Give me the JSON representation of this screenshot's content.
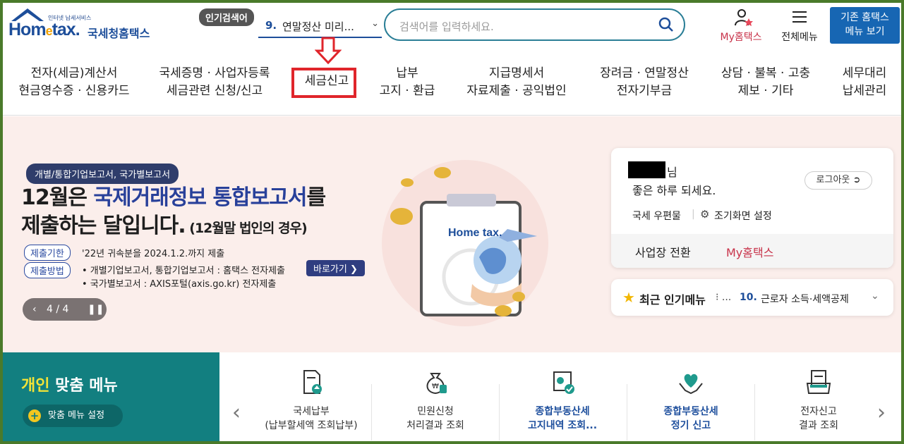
{
  "header": {
    "logo_tagline": "인터넷 납세서비스",
    "logo_word_a": "Hom",
    "logo_word_e": "e",
    "logo_word_b": "tax.",
    "logo_korean": "국세청홈택스",
    "popular_badge": "인기검색어",
    "popular_rank": "9.",
    "popular_term": "연말정산 미리...",
    "search_placeholder": "검색어를 입력하세요.",
    "my_hometax": "My홈택스",
    "all_menu": "전체메뉴",
    "old_menu_line1": "기존 홈택스",
    "old_menu_line2": "메뉴 보기"
  },
  "nav": [
    {
      "line1": "전자(세금)계산서",
      "line2": "현금영수증 · 신용카드"
    },
    {
      "line1": "국세증명 · 사업자등록",
      "line2": "세금관련 신청/신고"
    },
    {
      "line1": "세금신고",
      "line2": ""
    },
    {
      "line1": "납부",
      "line2": "고지 · 환급"
    },
    {
      "line1": "지급명세서",
      "line2": "자료제출 · 공익법인"
    },
    {
      "line1": "장려금 · 연말정산",
      "line2": "전자기부금"
    },
    {
      "line1": "상담 · 불복 · 고충",
      "line2": "제보 · 기타"
    },
    {
      "line1": "세무대리",
      "line2": "납세관리"
    }
  ],
  "hero": {
    "tag": "개별/통합기업보고서, 국가별보고서",
    "headline_a": "12월은 ",
    "headline_blue": "국제거래정보 통합보고서",
    "headline_b": "를",
    "headline_line2": "제출하는 달입니다.",
    "headline_small": " (12월말 법인의 경우)",
    "deadline_label": "제출기한",
    "deadline_text": "'22년 귀속분을 2024.1.2.까지 제출",
    "method_label": "제출방법",
    "method_text1": "• 개별기업보고서, 통합기업보고서 : 홈택스 전자제출",
    "method_text2": "• 국가별보고서 : AXIS포털(axis.go.kr) 전자제출",
    "goto_label": "바로가기 ❯",
    "pager_text": "4 / 4",
    "illus_logo": "Home tax."
  },
  "user_card": {
    "nim": "님",
    "greeting": "좋은 하루 되세요.",
    "logout": "로그아웃",
    "mailbox": "국세 우편물",
    "init_setting": "조기화면 설정",
    "biz_switch": "사업장 전환",
    "my_hometax": "My홈택스"
  },
  "recent": {
    "title": "최근 인기메뉴",
    "dots": "⁝ ...",
    "rank": "10.",
    "item": "근로자 소득·세액공제"
  },
  "personal": {
    "title_a": "개인",
    "title_b": " 맞춤 메뉴",
    "setting": "맞춤 메뉴 설정"
  },
  "quick_menu": [
    {
      "line1": "국세납부",
      "line2": "(납부할세액 조회납부)",
      "highlight": false
    },
    {
      "line1": "민원신청",
      "line2": "처리결과 조회",
      "highlight": false
    },
    {
      "line1": "종합부동산세",
      "line2": "고지내역 조회...",
      "highlight": true
    },
    {
      "line1": "종합부동산세",
      "line2": "정기 신고",
      "highlight": true
    },
    {
      "line1": "전자신고",
      "line2": "결과 조회",
      "highlight": false
    }
  ]
}
